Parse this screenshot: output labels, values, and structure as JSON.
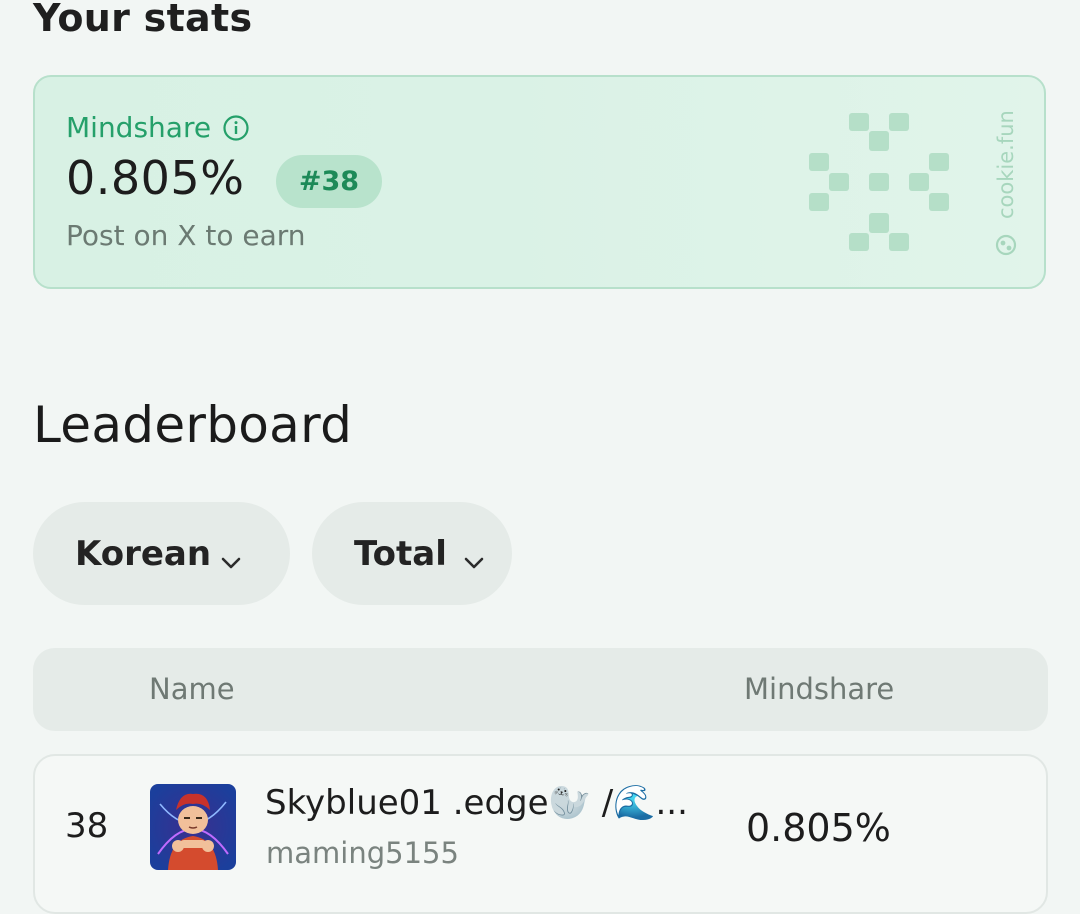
{
  "stats": {
    "heading": "Your stats",
    "mindshare_label": "Mindshare",
    "mindshare_value": "0.805%",
    "rank": "#38",
    "cta": "Post on X to earn",
    "brand": "cookie.fun",
    "accent_color": "#25a06a"
  },
  "leaderboard": {
    "title": "Leaderboard",
    "filters": {
      "language": "Korean",
      "period": "Total"
    },
    "columns": [
      "Name",
      "Mindshare"
    ],
    "rows": [
      {
        "rank": "38",
        "name": "Skyblue01 .edge🦭 /🌊...",
        "handle": "maming5155",
        "mindshare": "0.805%"
      }
    ]
  },
  "icons": {
    "info": "info-icon",
    "dropdown": "chevron-down-icon",
    "logo": "cookie-logo-icon"
  }
}
